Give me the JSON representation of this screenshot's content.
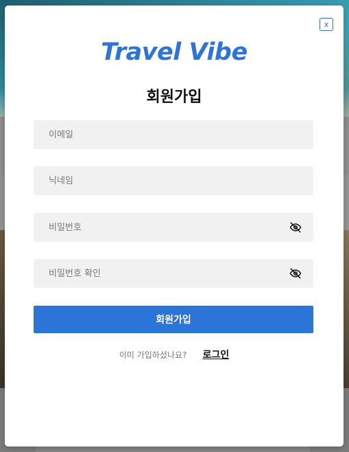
{
  "modal": {
    "close_label": "x",
    "brand": "Travel Vibe",
    "title": "회원가입",
    "fields": {
      "email_placeholder": "이메일",
      "nickname_placeholder": "닉네임",
      "password_placeholder": "비밀번호",
      "password_confirm_placeholder": "비밀번호 확인"
    },
    "submit_label": "회원가입",
    "login_question": "이미 가입하셨나요?",
    "login_link": "로그인"
  },
  "colors": {
    "accent": "#2c74d8",
    "field_bg": "#f1f1f1"
  },
  "icons": {
    "password_toggle": "eye-off-icon",
    "password_confirm_toggle": "eye-off-icon"
  }
}
